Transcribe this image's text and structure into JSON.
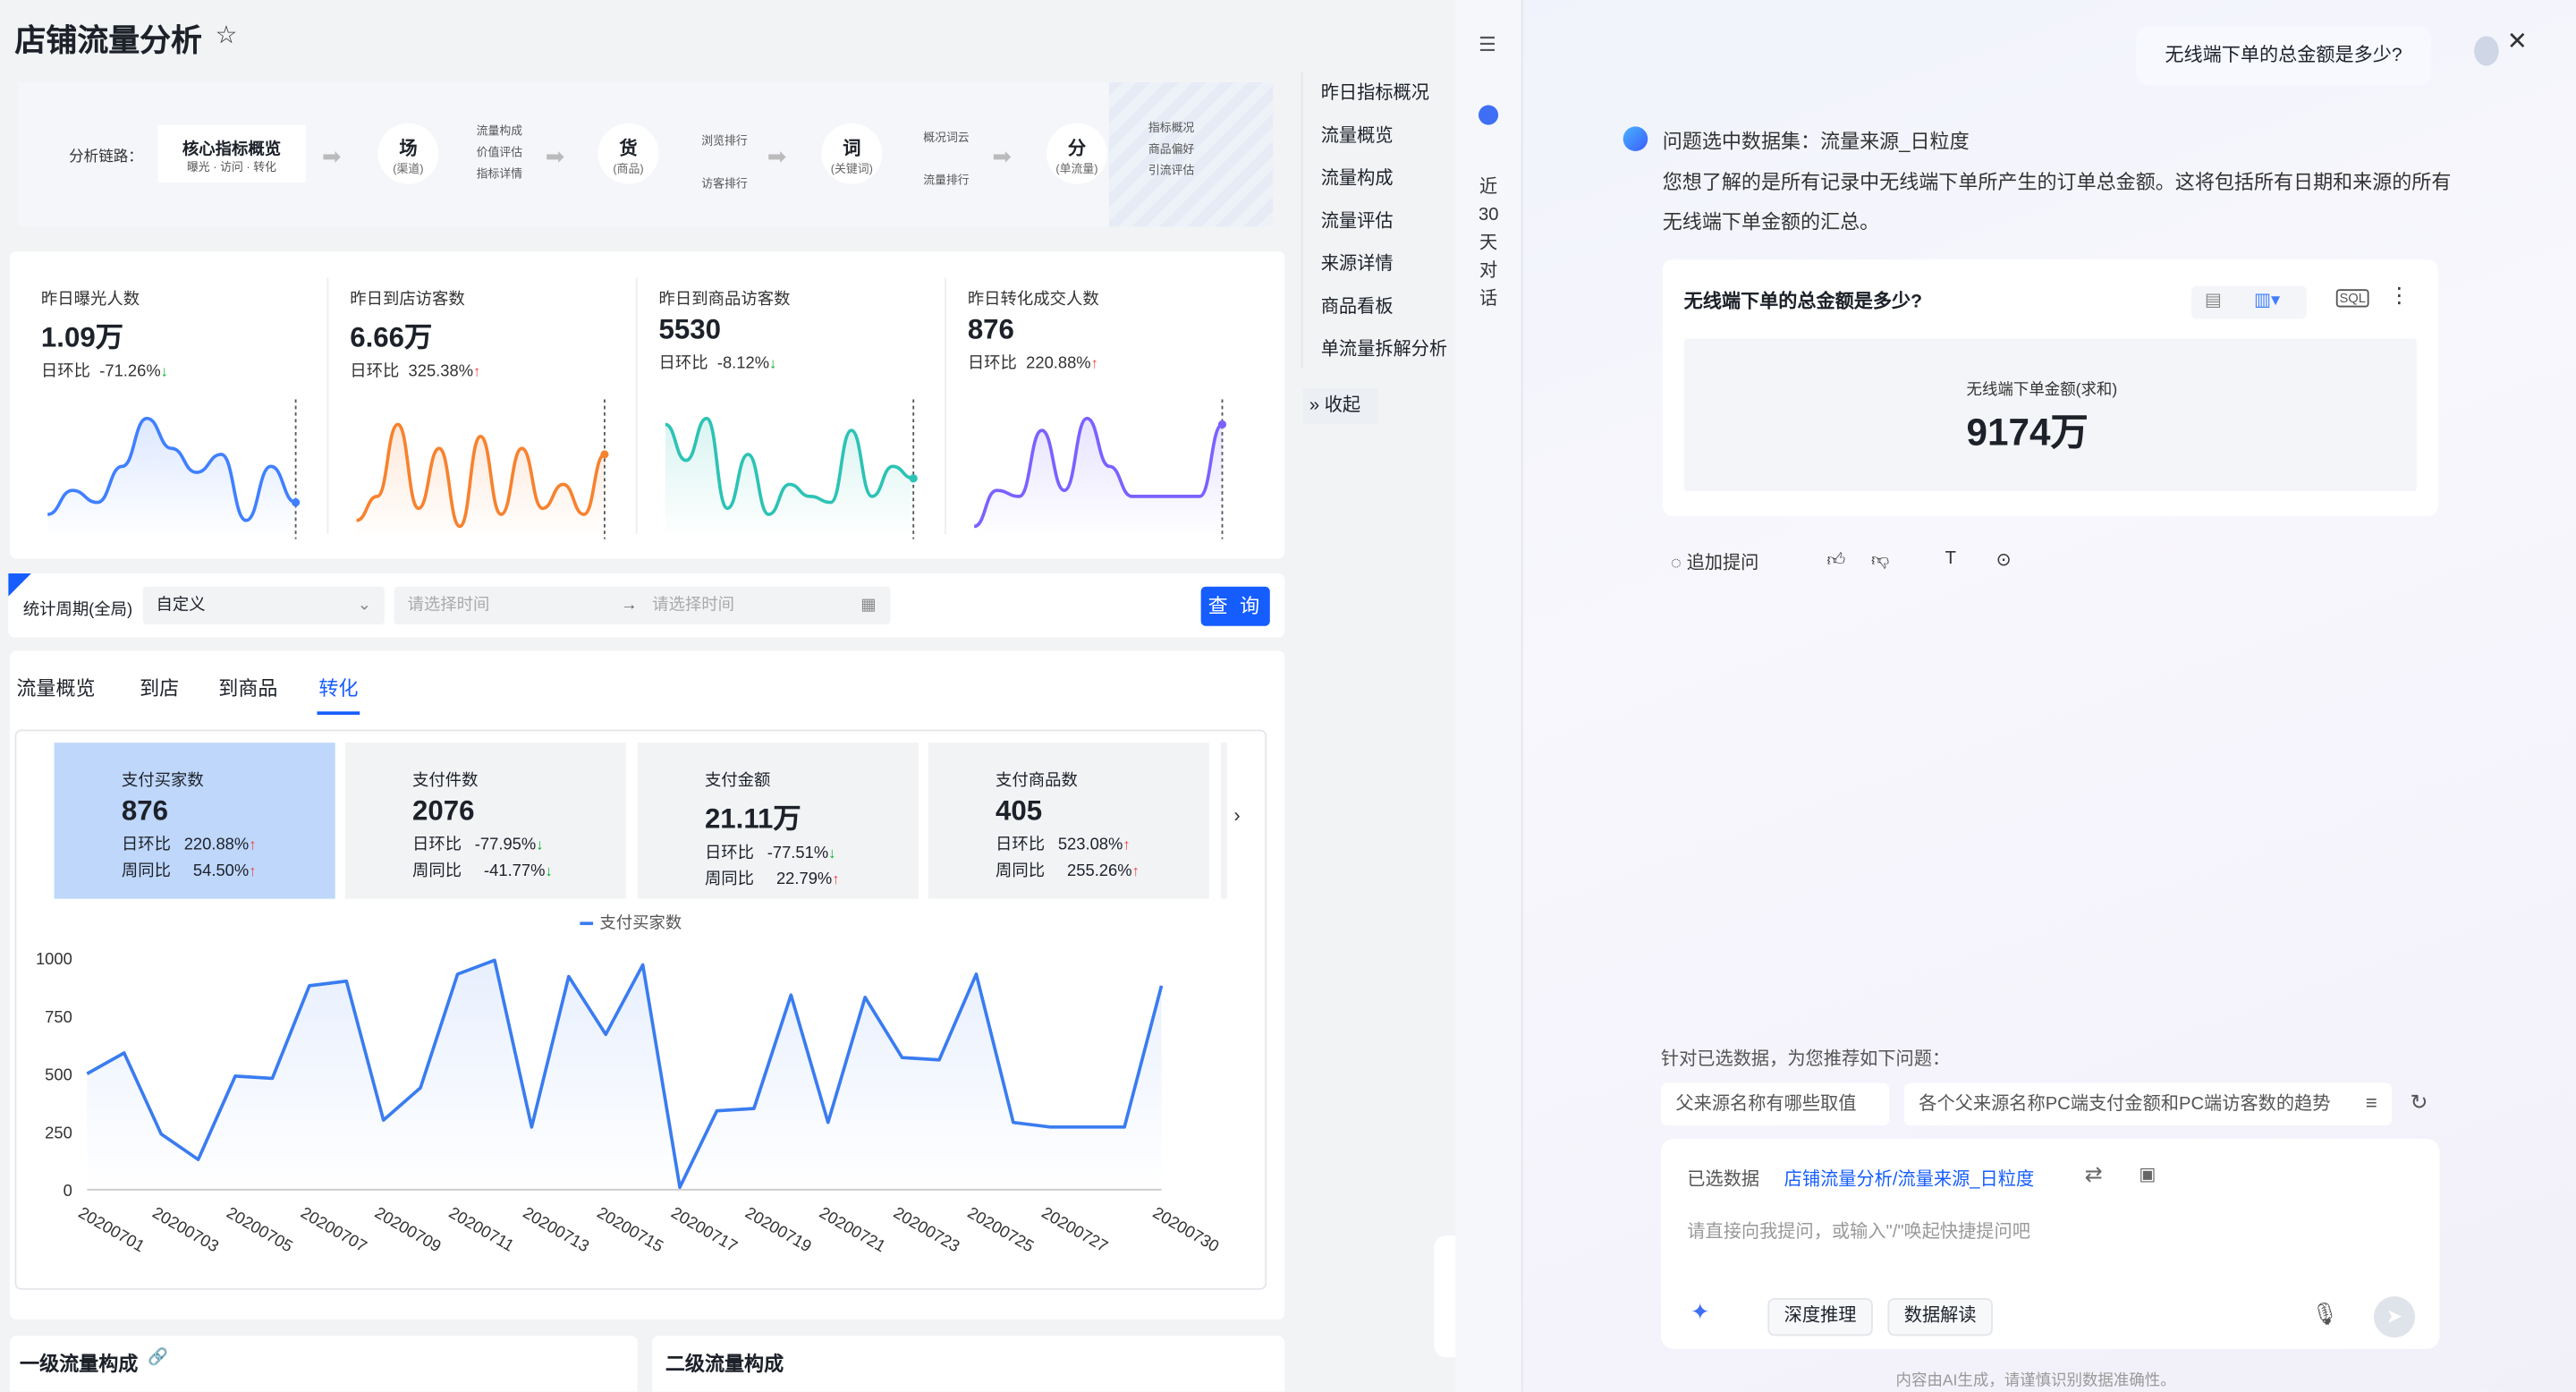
{
  "page": {
    "title": "店铺流量分析"
  },
  "flow": {
    "label": "分析链路：",
    "core": {
      "title": "核心指标概览",
      "sub": "曝光 · 访问 · 转化"
    },
    "nodes": [
      {
        "title": "场",
        "sub": "(渠道)",
        "items": [
          "流量构成",
          "价值评估",
          "指标详情"
        ]
      },
      {
        "title": "货",
        "sub": "(商品)",
        "items": [
          "浏览排行",
          "访客排行"
        ]
      },
      {
        "title": "词",
        "sub": "(关键词)",
        "items": [
          "概况词云",
          "流量排行"
        ]
      },
      {
        "title": "分",
        "sub": "(单流量)",
        "items": [
          "指标概况",
          "商品偏好",
          "引流评估"
        ]
      }
    ]
  },
  "metrics": [
    {
      "name": "昨日曝光人数",
      "value": "1.09万",
      "change_label": "日环比",
      "change": "-71.26%",
      "dir": "down",
      "color": "#4080ff",
      "spark": [
        0.15,
        0.35,
        0.25,
        0.55,
        0.95,
        0.7,
        0.5,
        0.65,
        0.1,
        0.55,
        0.25
      ]
    },
    {
      "name": "昨日到店访客数",
      "value": "6.66万",
      "change_label": "日环比",
      "change": "325.38%",
      "dir": "up",
      "color": "#f7822f",
      "spark": [
        0.1,
        0.3,
        0.9,
        0.2,
        0.7,
        0.05,
        0.8,
        0.15,
        0.7,
        0.2,
        0.4,
        0.15,
        0.65
      ]
    },
    {
      "name": "昨日到商品访客数",
      "value": "5530",
      "change_label": "日环比",
      "change": "-8.12%",
      "dir": "down",
      "color": "#2cc3b5",
      "spark": [
        0.9,
        0.6,
        0.95,
        0.2,
        0.65,
        0.15,
        0.4,
        0.3,
        0.25,
        0.85,
        0.3,
        0.55,
        0.45
      ]
    },
    {
      "name": "昨日转化成交人数",
      "value": "876",
      "change_label": "日环比",
      "change": "220.88%",
      "dir": "up",
      "color": "#7b61ff",
      "spark": [
        0.05,
        0.35,
        0.3,
        0.85,
        0.35,
        0.95,
        0.55,
        0.3,
        0.3,
        0.3,
        0.3,
        0.9
      ]
    }
  ],
  "sidenav": {
    "items": [
      "昨日指标概况",
      "流量概览",
      "流量构成",
      "流量评估",
      "来源详情",
      "商品看板",
      "单流量拆解分析"
    ],
    "collapse": "收起"
  },
  "filter": {
    "label": "统计周期(全局)",
    "select_value": "自定义",
    "start_ph": "请选择时间",
    "end_ph": "请选择时间",
    "query": "查 询"
  },
  "tabs": [
    "流量概览",
    "到店",
    "到商品",
    "转化"
  ],
  "kpis": [
    {
      "name": "支付买家数",
      "value": "876",
      "r1_label": "日环比",
      "r1": "220.88%",
      "r1_dir": "up",
      "r2_label": "周同比",
      "r2": "54.50%",
      "r2_dir": "up"
    },
    {
      "name": "支付件数",
      "value": "2076",
      "r1_label": "日环比",
      "r1": "-77.95%",
      "r1_dir": "down",
      "r2_label": "周同比",
      "r2": "-41.77%",
      "r2_dir": "down"
    },
    {
      "name": "支付金额",
      "value": "21.11万",
      "r1_label": "日环比",
      "r1": "-77.51%",
      "r1_dir": "down",
      "r2_label": "周同比",
      "r2": "22.79%",
      "r2_dir": "up"
    },
    {
      "name": "支付商品数",
      "value": "405",
      "r1_label": "日环比",
      "r1": "523.08%",
      "r1_dir": "up",
      "r2_label": "周同比",
      "r2": "255.26%",
      "r2_dir": "up"
    }
  ],
  "chart_data": {
    "type": "line",
    "legend": "支付买家数",
    "ylim": [
      0,
      1000
    ],
    "yticks": [
      0,
      250,
      500,
      750,
      1000
    ],
    "x": [
      "20200701",
      "20200702",
      "20200703",
      "20200704",
      "20200705",
      "20200706",
      "20200707",
      "20200708",
      "20200709",
      "20200710",
      "20200711",
      "20200712",
      "20200713",
      "20200714",
      "20200715",
      "20200716",
      "20200717",
      "20200718",
      "20200719",
      "20200720",
      "20200721",
      "20200722",
      "20200723",
      "20200724",
      "20200725",
      "20200726",
      "20200727",
      "20200728",
      "20200729",
      "20200730"
    ],
    "xtick_labels": [
      "20200701",
      "20200703",
      "20200705",
      "20200707",
      "20200709",
      "20200711",
      "20200713",
      "20200715",
      "20200717",
      "20200719",
      "20200721",
      "20200723",
      "20200725",
      "20200727",
      "20200730"
    ],
    "series": [
      {
        "name": "支付买家数",
        "color": "#3a7cf0",
        "values": [
          500,
          590,
          240,
          130,
          490,
          480,
          880,
          900,
          300,
          440,
          930,
          990,
          270,
          920,
          670,
          970,
          10,
          340,
          350,
          840,
          290,
          830,
          570,
          560,
          930,
          290,
          270,
          270,
          270,
          880
        ]
      }
    ]
  },
  "sections": {
    "first": "一级流量构成",
    "second": "二级流量构成"
  },
  "ai": {
    "rail_text": "近30天对话",
    "question": "无线端下单的总金额是多少?",
    "dataset_line": "问题选中数据集：流量来源_日粒度",
    "answer": "您想了解的是所有记录中无线端下单所产生的订单总金额。这将包括所有日期和来源的所有无线端下单金额的汇总。",
    "result_title": "无线端下单的总金额是多少?",
    "result_label": "无线端下单金额(求和)",
    "result_value": "9174万",
    "followup": "追加提问",
    "rec_label": "针对已选数据，为您推荐如下问题：",
    "chips": [
      "父来源名称有哪些取值",
      "各个父来源名称PC端支付金额和PC端访客数的趋势"
    ],
    "selected_label": "已选数据",
    "selected_value": "店铺流量分析/流量来源_日粒度",
    "input_ph": "请直接向我提问，或输入\"/\"唤起快捷提问吧",
    "btn_deep": "深度推理",
    "btn_interp": "数据解读",
    "footer": "内容由AI生成，请谨慎识别数据准确性。"
  }
}
